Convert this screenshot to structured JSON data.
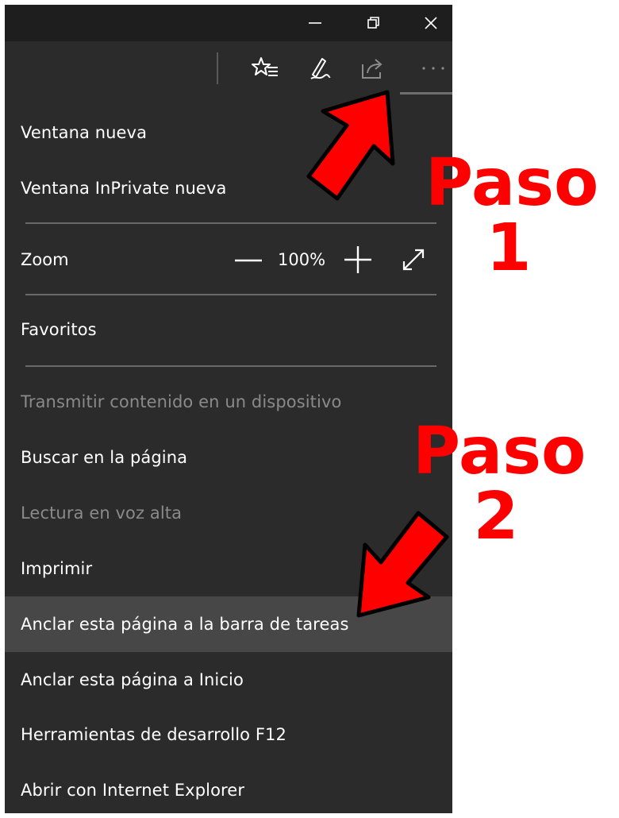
{
  "window": {
    "minimize_icon": "minimize-icon",
    "restore_icon": "restore-icon",
    "close_icon": "close-icon"
  },
  "toolbar": {
    "icons": [
      "favorites-star-list-icon",
      "pen-annotate-icon",
      "share-icon",
      "more-dots-icon"
    ]
  },
  "menu": {
    "new_window": "Ventana nueva",
    "inprivate_window": "Ventana InPrivate nueva",
    "zoom_label": "Zoom",
    "zoom_value": "100%",
    "favorites": "Favoritos",
    "cast": "Transmitir contenido en un dispositivo",
    "find": "Buscar en la página",
    "read_aloud": "Lectura en voz alta",
    "print": "Imprimir",
    "pin_taskbar": "Anclar esta página a la barra de tareas",
    "pin_start": "Anclar esta página a Inicio",
    "devtools": "Herramientas de desarrollo F12",
    "open_ie": "Abrir con Internet Explorer"
  },
  "annotations": {
    "step1_word": "Paso",
    "step1_num": "1",
    "step2_word": "Paso",
    "step2_num": "2",
    "color": "#ff0000"
  },
  "colors": {
    "titlebar": "#1e1e1e",
    "menu_bg": "#2b2b2b",
    "highlight": "#474747",
    "disabled_text": "#8a8a8a"
  }
}
